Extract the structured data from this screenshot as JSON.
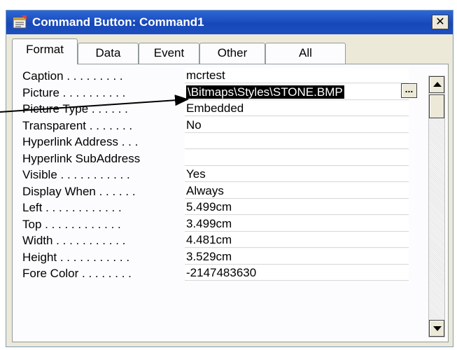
{
  "window": {
    "title": "Command Button: Command1",
    "close_glyph": "✕",
    "title_icon": "property-sheet-icon"
  },
  "tabs": [
    {
      "label": "Format",
      "active": true
    },
    {
      "label": "Data",
      "active": false
    },
    {
      "label": "Event",
      "active": false
    },
    {
      "label": "Other",
      "active": false
    },
    {
      "label": "All",
      "active": false
    }
  ],
  "properties": [
    {
      "label": "Caption . . . . . . . . .",
      "value": "mcrtest"
    },
    {
      "label": "Picture . . . . . . . . . .",
      "value": "\\Bitmaps\\Styles\\STONE.BMP",
      "selected": true
    },
    {
      "label": "Picture Type . . . . . .",
      "value": "Embedded"
    },
    {
      "label": "Transparent . . . . . . .",
      "value": "No"
    },
    {
      "label": "Hyperlink Address . . .",
      "value": ""
    },
    {
      "label": "Hyperlink SubAddress",
      "value": ""
    },
    {
      "label": "Visible . . . . . . . . . . .",
      "value": "Yes"
    },
    {
      "label": "Display When . . . . . .",
      "value": "Always"
    },
    {
      "label": "Left . . . . . . . . . . . .",
      "value": "5.499cm"
    },
    {
      "label": "Top . . . . . . . . . . . .",
      "value": "3.499cm"
    },
    {
      "label": "Width . . . . . . . . . . .",
      "value": "4.481cm"
    },
    {
      "label": "Height . . . . . . . . . . .",
      "value": "3.529cm"
    },
    {
      "label": "Fore Color . . . . . . . .",
      "value": "-2147483630"
    }
  ],
  "builder_button": {
    "label": "..."
  },
  "colors": {
    "titlebar": "#1c4fc2",
    "selection": "#000000",
    "dialog": "#ece9d8"
  }
}
